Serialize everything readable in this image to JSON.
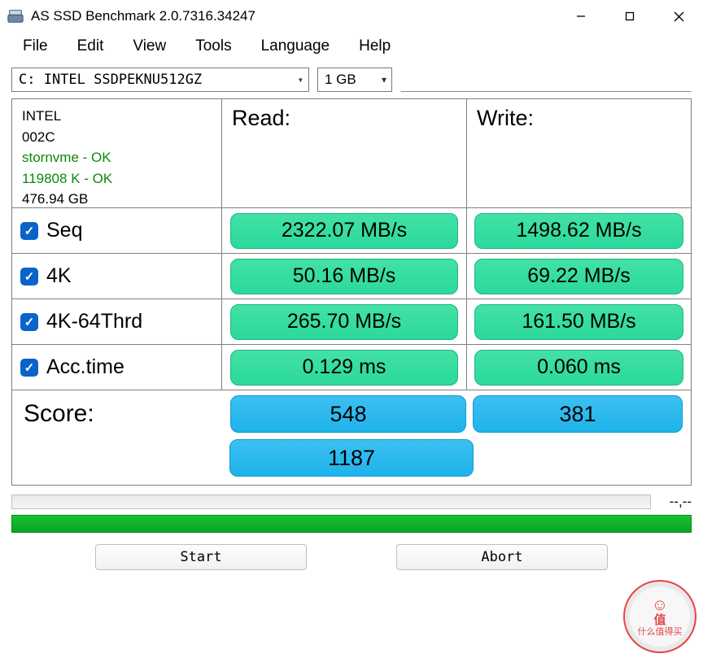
{
  "title": "AS SSD Benchmark 2.0.7316.34247",
  "menu": {
    "file": "File",
    "edit": "Edit",
    "view": "View",
    "tools": "Tools",
    "language": "Language",
    "help": "Help"
  },
  "drive_selected": "C: INTEL SSDPEKNU512GZ",
  "size_selected": "1 GB",
  "device": {
    "model": "INTEL",
    "fw": "002C",
    "driver": "stornvme - OK",
    "align": "119808 K - OK",
    "capacity": "476.94 GB"
  },
  "headers": {
    "read": "Read:",
    "write": "Write:"
  },
  "tests": {
    "seq": {
      "label": "Seq",
      "read": "2322.07 MB/s",
      "write": "1498.62 MB/s"
    },
    "fourk": {
      "label": "4K",
      "read": "50.16 MB/s",
      "write": "69.22 MB/s"
    },
    "fourk64": {
      "label": "4K-64Thrd",
      "read": "265.70 MB/s",
      "write": "161.50 MB/s"
    },
    "acc": {
      "label": "Acc.time",
      "read": "0.129 ms",
      "write": "0.060 ms"
    }
  },
  "score": {
    "label": "Score:",
    "read": "548",
    "write": "381",
    "total": "1187"
  },
  "progress_pct": "--,--",
  "buttons": {
    "start": "Start",
    "abort": "Abort"
  },
  "watermark": {
    "text": "什么值得买",
    "sub": "值"
  }
}
